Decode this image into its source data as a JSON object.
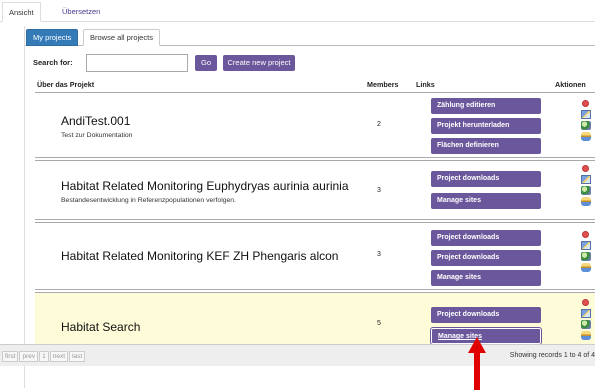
{
  "top_tabs": [
    "Ansicht",
    "Übersetzen"
  ],
  "panel_tabs": [
    "My projects",
    "Browse all projects"
  ],
  "search": {
    "label": "Search for:",
    "value": "",
    "go_label": "Go",
    "create_label": "Create new project"
  },
  "table": {
    "headers": {
      "about": "Über das Projekt",
      "members": "Members",
      "links": "Links",
      "actions": "Aktionen"
    },
    "rows": [
      {
        "title": "AndiTest.001",
        "description": "Test zur Dokumentation",
        "members": "2",
        "links": [
          "Zählung editieren",
          "Projekt herunterladen",
          "Flächen definieren"
        ],
        "highlighted": false
      },
      {
        "title": "Habitat Related Monitoring Euphydryas aurinia aurinia",
        "description": "Bestandesentwicklung in Referenzpopulationen verfolgen.",
        "members": "3",
        "links": [
          "Project downloads",
          "Manage sites"
        ],
        "highlighted": false
      },
      {
        "title": "Habitat Related Monitoring KEF ZH Phengaris alcon",
        "description": "",
        "members": "3",
        "links": [
          "Project downloads",
          "Project downloads",
          "Manage sites"
        ],
        "highlighted": false
      },
      {
        "title": "Habitat Search",
        "description": "",
        "members": "5",
        "links": [
          "Project downloads",
          "Manage sites"
        ],
        "highlighted": true
      }
    ],
    "action_icons": [
      "delete-icon",
      "edit-icon",
      "forward-icon",
      "users-icon"
    ]
  },
  "pager": {
    "first": "first",
    "prev": "prev",
    "page": "1",
    "next": "next",
    "last": "last"
  },
  "records_text": "Showing records 1 to 4 of 4",
  "colors": {
    "accent": "#6b579b",
    "tab_active": "#337ab7",
    "highlight_row": "#fdfbd8",
    "arrow": "#e00000"
  }
}
